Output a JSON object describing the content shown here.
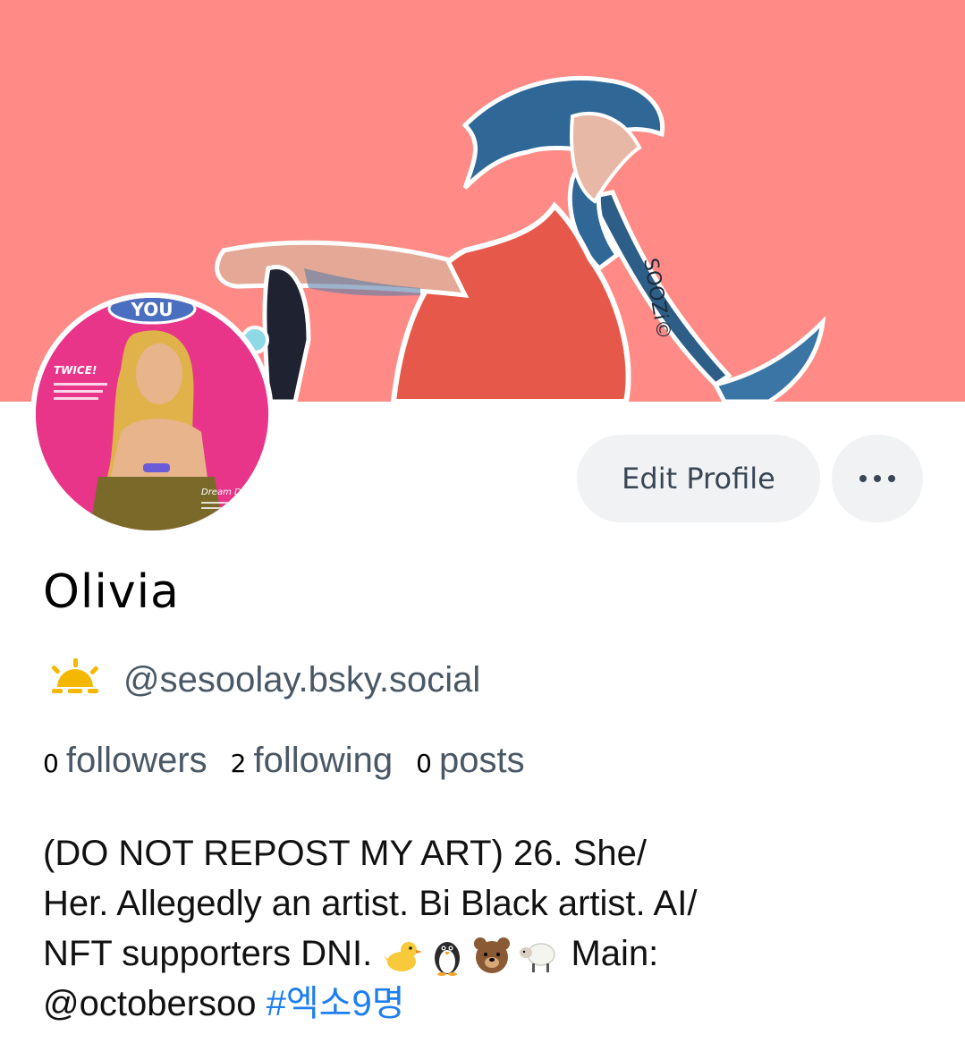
{
  "profile": {
    "display_name": "Olivia",
    "handle": "@sesoolay.bsky.social",
    "banner_signature": "SOOZi©",
    "avatar_text": {
      "title": "YOU",
      "twice": "TWICE!",
      "dream": "Dream Drea"
    },
    "stats": [
      {
        "count": "0",
        "label": "followers"
      },
      {
        "count": "2",
        "label": "following"
      },
      {
        "count": "0",
        "label": "posts"
      }
    ],
    "bio": {
      "line1": "(DO NOT REPOST MY ART) 26. She/",
      "line2": "Her. Allegedly an artist. Bi Black artist. AI/",
      "line3_before": "NFT supporters DNI. ",
      "line3_after": " Main:",
      "line4_mention": "@octobersoo ",
      "hashtag": "#엑소9명",
      "emojis": [
        "chick-icon",
        "penguin-icon",
        "bear-icon",
        "sheep-icon"
      ]
    }
  },
  "actions": {
    "edit_label": "Edit Profile",
    "more_icon": "ellipsis-icon"
  },
  "colors": {
    "banner_bg": "#ff8a86",
    "link": "#1d7ef0",
    "muted_text": "#4a5866",
    "button_bg": "#f0f2f4"
  }
}
